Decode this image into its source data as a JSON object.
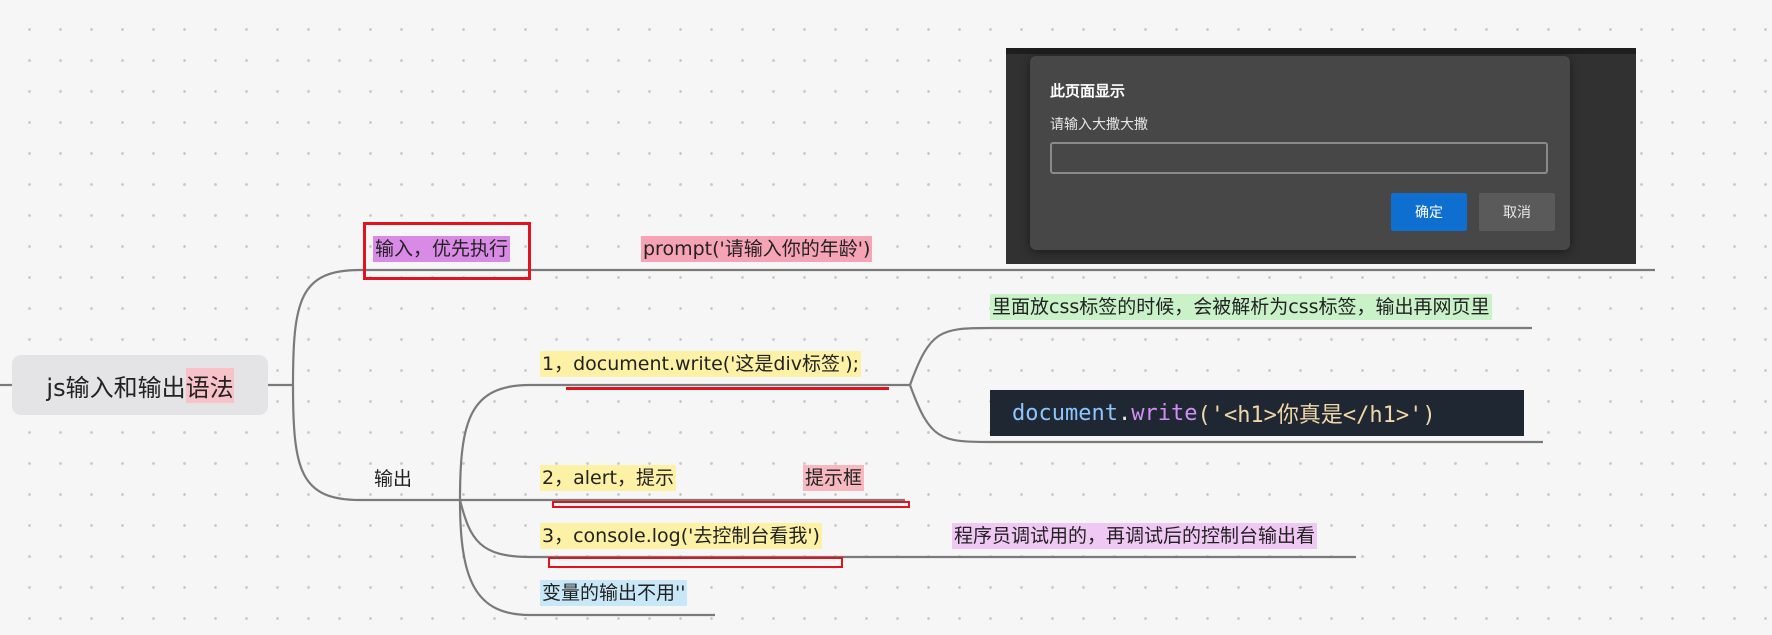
{
  "root": {
    "label_main": "js输入和输出",
    "label_tail": "语法"
  },
  "input_branch": {
    "label": "输入，优先执行",
    "code": "prompt('请输入你的年龄')"
  },
  "output_branch": {
    "label": "输出",
    "items": [
      {
        "label": "1，document.write('这是div标签');"
      },
      {
        "label": "2，alert，提示"
      },
      {
        "label": "3，console.log('去控制台看我')"
      },
      {
        "label": "变量的输出不用''"
      }
    ],
    "write_note": "里面放css标签的时候，会被解析为css标签，输出再网页里",
    "code_image": {
      "obj": "document",
      "dot": ".",
      "fn": "write",
      "args": "('<h1>你真是</h1>')"
    },
    "alert_note": "提示框",
    "console_note": "程序员调试用的，再调试后的控制台输出看"
  },
  "dialog": {
    "title": "此页面显示",
    "message": "请输入大撒大撒",
    "input_value": "",
    "ok_label": "确定",
    "cancel_label": "取消"
  }
}
